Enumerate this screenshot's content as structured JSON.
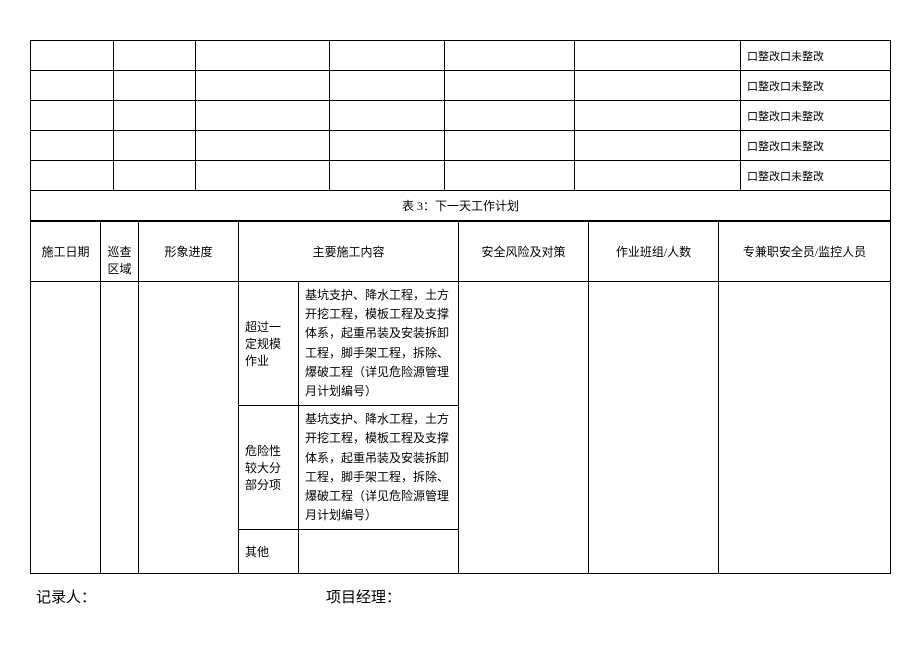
{
  "checkbox_status": "口整改口未整改",
  "section_header": "表 3：下一天工作计划",
  "headers": {
    "date": "施工日期",
    "area": "巡查区域",
    "progress": "形象进度",
    "content": "主要施工内容",
    "risk": "安全风险及对策",
    "team": "作业班组/人数",
    "safety": "专兼职安全员/监控人员"
  },
  "rows": [
    {
      "label": "超过一定规模作业",
      "desc": "基坑支护、降水工程，土方开挖工程，模板工程及支撑体系，起重吊装及安装拆卸工程，脚手架工程，拆除、爆破工程（详见危险源管理月计划编号）"
    },
    {
      "label": "危险性较大分部分项",
      "desc": "基坑支护、降水工程，土方开挖工程，模板工程及支撑体系，起重吊装及安装拆卸工程，脚手架工程，拆除、爆破工程（详见危险源管理月计划编号）"
    },
    {
      "label": "其他",
      "desc": ""
    }
  ],
  "signature": {
    "recorder": "记录人：",
    "manager": "项目经理："
  }
}
